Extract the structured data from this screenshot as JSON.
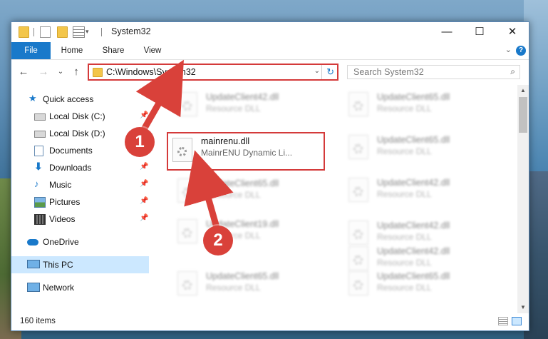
{
  "window": {
    "title": "System32",
    "caption": {
      "minimize": "—",
      "maximize": "☐",
      "close": "✕"
    }
  },
  "ribbon": {
    "tabs": [
      "File",
      "Home",
      "Share",
      "View"
    ],
    "help": "?",
    "expand": "⌄"
  },
  "navigation": {
    "back": "←",
    "forward": "→",
    "recent": "⌄",
    "up": "↑",
    "address": "C:\\Windows\\System32",
    "address_dropdown": "⌄",
    "refresh": "↻",
    "search_placeholder": "Search System32",
    "search_icon": "⌕"
  },
  "sidebar": {
    "items": [
      {
        "label": "Quick access",
        "icon": "star-icon"
      },
      {
        "label": "Local Disk (C:)",
        "icon": "drive-icon",
        "pinned": true
      },
      {
        "label": "Local Disk (D:)",
        "icon": "drive-icon"
      },
      {
        "label": "Documents",
        "icon": "documents-icon"
      },
      {
        "label": "Downloads",
        "icon": "download-icon",
        "pinned": true
      },
      {
        "label": "Music",
        "icon": "music-icon",
        "pinned": true
      },
      {
        "label": "Pictures",
        "icon": "pictures-icon",
        "pinned": true
      },
      {
        "label": "Videos",
        "icon": "videos-icon",
        "pinned": true
      },
      {
        "label": "OneDrive",
        "icon": "cloud-icon"
      },
      {
        "label": "This PC",
        "icon": "computer-icon",
        "selected": true
      },
      {
        "label": "Network",
        "icon": "network-icon"
      }
    ],
    "pin_glyph": "📌"
  },
  "files": {
    "highlighted": {
      "name": "mainrenu.dll",
      "type": "MainrENU Dynamic Li..."
    },
    "left_column": [
      {
        "name": "UpdateClient42.dll",
        "type": "Resource DLL"
      },
      {
        "name": "UpdateClient65.dll",
        "type": "Resource DLL"
      },
      {
        "name": "UpdateClient19.dll",
        "type": "Resource DLL"
      },
      {
        "name": "UpdateClient65.dll",
        "type": "Resource DLL"
      }
    ],
    "right_column": [
      {
        "name": "UpdateClient65.dll",
        "type": "Resource DLL"
      },
      {
        "name": "UpdateClient65.dll",
        "type": "Resource DLL"
      },
      {
        "name": "UpdateClient42.dll",
        "type": "Resource DLL"
      },
      {
        "name": "UpdateClient42.dll",
        "type": "Resource DLL"
      },
      {
        "name": "UpdateClient42.dll",
        "type": "Resource DLL"
      },
      {
        "name": "UpdateClient65.dll",
        "type": "Resource DLL"
      }
    ]
  },
  "status": {
    "item_count": "160 items"
  },
  "annotations": {
    "step1": "1",
    "step2": "2",
    "color": "#d9413a"
  }
}
